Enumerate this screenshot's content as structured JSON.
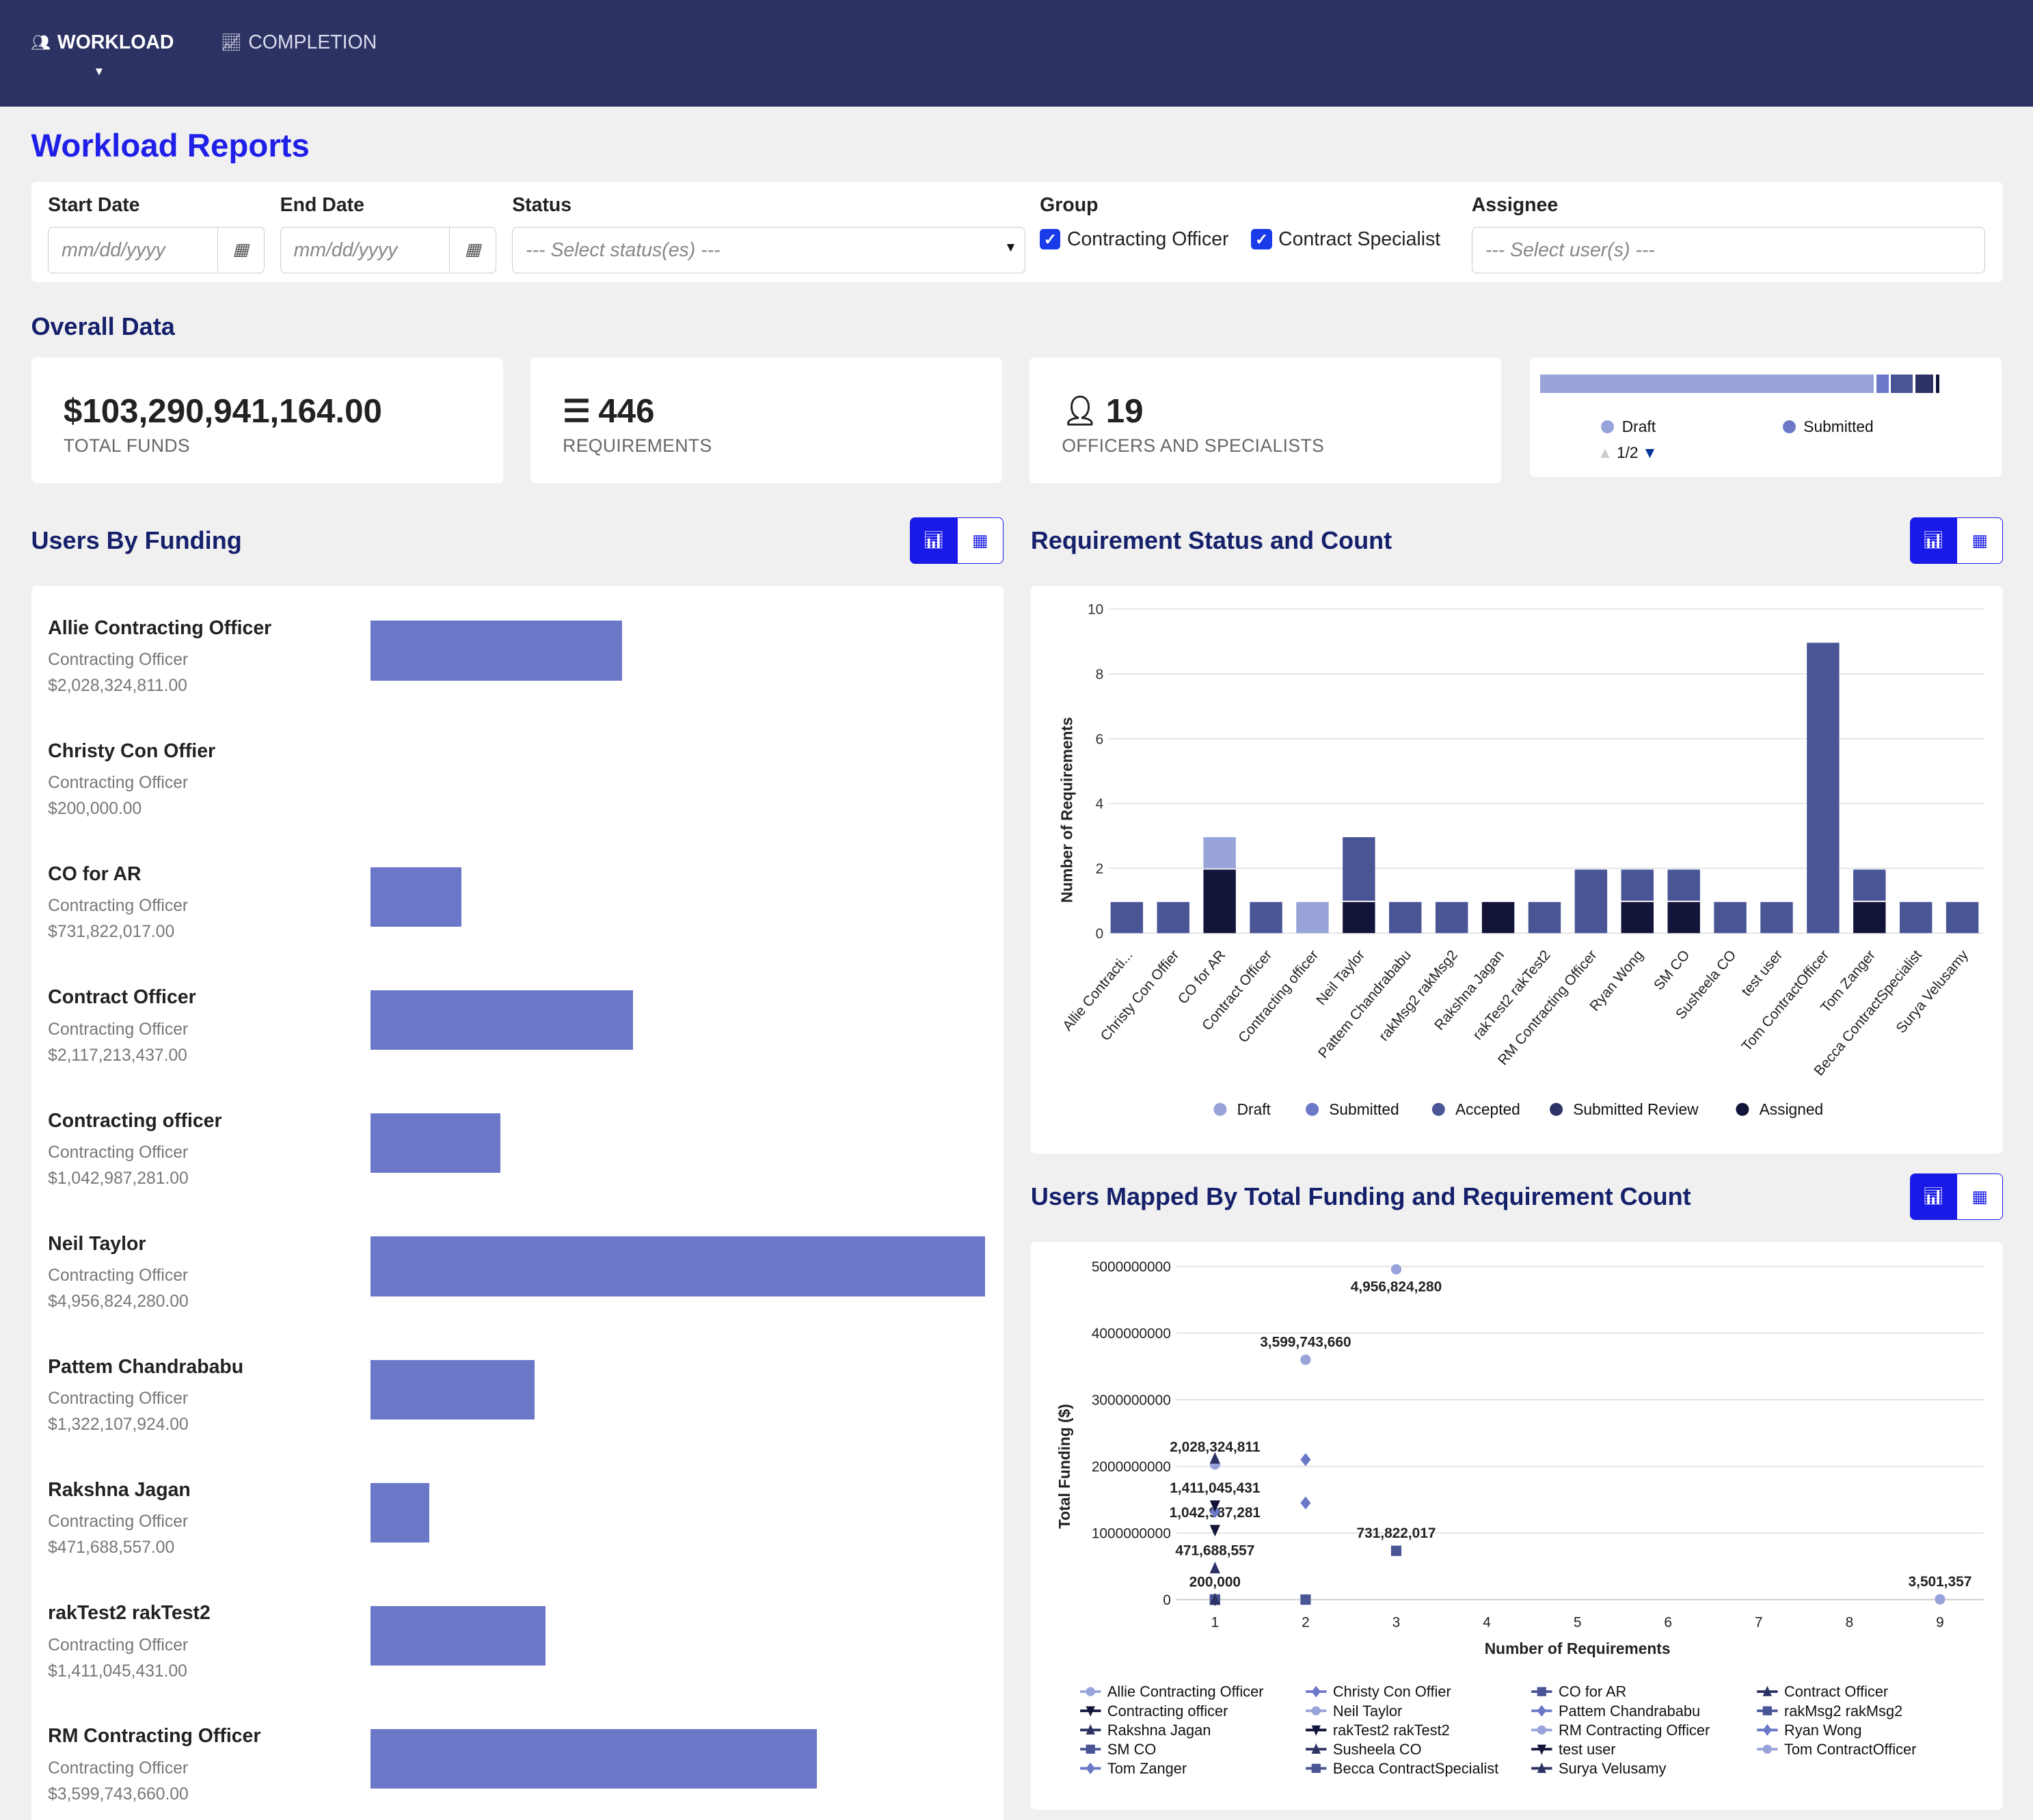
{
  "nav": {
    "items": [
      {
        "label": "WORKLOAD",
        "icon": "users-icon",
        "active": true
      },
      {
        "label": "COMPLETION",
        "icon": "line-chart-icon",
        "active": false
      }
    ]
  },
  "page": {
    "title": "Workload Reports"
  },
  "filters": {
    "start_date": {
      "label": "Start Date",
      "placeholder": "mm/dd/yyyy"
    },
    "end_date": {
      "label": "End Date",
      "placeholder": "mm/dd/yyyy"
    },
    "status": {
      "label": "Status",
      "placeholder": "--- Select status(es) ---"
    },
    "group": {
      "label": "Group",
      "options": [
        {
          "label": "Contracting Officer",
          "checked": true
        },
        {
          "label": "Contract Specialist",
          "checked": true
        }
      ]
    },
    "assignee": {
      "label": "Assignee",
      "placeholder": "--- Select user(s) ---"
    }
  },
  "overall": {
    "title": "Overall Data",
    "funds": {
      "value": "$103,290,941,164.00",
      "label": "TOTAL FUNDS"
    },
    "requirements": {
      "value": "446",
      "label": "REQUIREMENTS",
      "icon": "list-icon"
    },
    "officers": {
      "value": "19",
      "label": "OFFICERS AND SPECIALISTS",
      "icon": "user-icon"
    },
    "status_bar": {
      "segments": [
        {
          "name": "Draft",
          "fraction": 0.845,
          "color": "#97a3d9"
        },
        {
          "name": "Submitted",
          "fraction": 0.03,
          "color": "#6b78c8"
        },
        {
          "name": "Accepted",
          "fraction": 0.055,
          "color": "#4a5596"
        },
        {
          "name": "Submitted Review",
          "fraction": 0.045,
          "color": "#2c3263"
        },
        {
          "name": "Assigned",
          "fraction": 0.01,
          "color": "#12143a"
        }
      ],
      "legend": [
        "Draft",
        "Submitted"
      ],
      "page": "1/2"
    }
  },
  "users_by_funding": {
    "title": "Users By Funding",
    "max": 4956824280,
    "items": [
      {
        "name": "Allie Contracting Officer",
        "group": "Contracting Officer",
        "amount": "$2,028,324,811.00",
        "value": 2028324811
      },
      {
        "name": "Christy Con Offier",
        "group": "Contracting Officer",
        "amount": "$200,000.00",
        "value": 200000
      },
      {
        "name": "CO for AR",
        "group": "Contracting Officer",
        "amount": "$731,822,017.00",
        "value": 731822017
      },
      {
        "name": "Contract Officer",
        "group": "Contracting Officer",
        "amount": "$2,117,213,437.00",
        "value": 2117213437
      },
      {
        "name": "Contracting officer",
        "group": "Contracting Officer",
        "amount": "$1,042,987,281.00",
        "value": 1042987281
      },
      {
        "name": "Neil Taylor",
        "group": "Contracting Officer",
        "amount": "$4,956,824,280.00",
        "value": 4956824280
      },
      {
        "name": "Pattem Chandrababu",
        "group": "Contracting Officer",
        "amount": "$1,322,107,924.00",
        "value": 1322107924
      },
      {
        "name": "Rakshna Jagan",
        "group": "Contracting Officer",
        "amount": "$471,688,557.00",
        "value": 471688557
      },
      {
        "name": "rakTest2 rakTest2",
        "group": "Contracting Officer",
        "amount": "$1,411,045,431.00",
        "value": 1411045431
      },
      {
        "name": "RM Contracting Officer",
        "group": "Contracting Officer",
        "amount": "$3,599,743,660.00",
        "value": 3599743660
      }
    ]
  },
  "chart_data": [
    {
      "type": "bar",
      "stacked": true,
      "title": "Requirement Status and Count",
      "ylabel": "Number of Requirements",
      "ylim": [
        0,
        10
      ],
      "yticks": [
        0,
        2,
        4,
        6,
        8,
        10
      ],
      "grid": true,
      "legend_position": "bottom",
      "categories": [
        "Allie Contracti...",
        "Christy Con Offier",
        "CO for AR",
        "Contract Officer",
        "Contracting officer",
        "Neil Taylor",
        "Pattem Chandrababu",
        "rakMsg2 rakMsg2",
        "Rakshna Jagan",
        "rakTest2 rakTest2",
        "RM Contracting Officer",
        "Ryan Wong",
        "SM CO",
        "Susheela CO",
        "test user",
        "Tom ContractOfficer",
        "Tom Zanger",
        "Becca ContractSpecialist",
        "Surya Velusamy"
      ],
      "series": [
        {
          "name": "Draft",
          "color": "#97a3d9",
          "values": [
            0,
            0,
            1,
            0,
            1,
            0,
            0,
            0,
            0,
            0,
            0,
            0,
            0,
            0,
            0,
            0,
            0,
            0,
            0
          ]
        },
        {
          "name": "Submitted",
          "color": "#6b78c8",
          "values": [
            0,
            0,
            0,
            0,
            0,
            0,
            0,
            0,
            0,
            0,
            0,
            0,
            0,
            0,
            0,
            0,
            0,
            0,
            0
          ]
        },
        {
          "name": "Accepted",
          "color": "#4a5596",
          "values": [
            1,
            1,
            0,
            1,
            0,
            2,
            1,
            1,
            0,
            1,
            2,
            1,
            1,
            1,
            1,
            9,
            1,
            1,
            1
          ]
        },
        {
          "name": "Submitted Review",
          "color": "#2c3263",
          "values": [
            0,
            0,
            0,
            0,
            0,
            0,
            0,
            0,
            0,
            0,
            0,
            0,
            0,
            0,
            0,
            0,
            0,
            0,
            0
          ]
        },
        {
          "name": "Assigned",
          "color": "#12143a",
          "values": [
            0,
            0,
            2,
            0,
            0,
            1,
            0,
            0,
            1,
            0,
            0,
            1,
            1,
            0,
            0,
            0,
            1,
            0,
            0
          ]
        }
      ]
    },
    {
      "type": "scatter",
      "title": "Users Mapped By Total Funding and Requirement Count",
      "xlabel": "Number of Requirements",
      "ylabel": "Total Funding ($)",
      "xlim": [
        1,
        9
      ],
      "xticks": [
        1,
        2,
        3,
        4,
        5,
        6,
        7,
        8,
        9
      ],
      "ylim": [
        0,
        5000000000
      ],
      "yticks": [
        "0",
        "1000000000",
        "2000000000",
        "3000000000",
        "4000000000",
        "5000000000"
      ],
      "grid": true,
      "legend_position": "bottom",
      "series": [
        {
          "name": "Allie Contracting Officer",
          "marker": "circle",
          "color": "#97a3d9",
          "x": 1,
          "y": 2028324811,
          "label": "2,028,324,811"
        },
        {
          "name": "Christy Con Offier",
          "marker": "diamond",
          "color": "#6b78c8",
          "x": 1,
          "y": 200000,
          "label": "200,000"
        },
        {
          "name": "CO for AR",
          "marker": "square",
          "color": "#4a5596",
          "x": 3,
          "y": 731822017,
          "label": "731,822,017"
        },
        {
          "name": "Contract Officer",
          "marker": "triangle",
          "color": "#2c3263",
          "x": 1,
          "y": 2117213437
        },
        {
          "name": "Contracting officer",
          "marker": "triangle-down",
          "color": "#12143a",
          "x": 1,
          "y": 1042987281,
          "label": "1,042,987,281"
        },
        {
          "name": "Neil Taylor",
          "marker": "circle",
          "color": "#97a3d9",
          "x": 3,
          "y": 4956824280,
          "label": "4,956,824,280"
        },
        {
          "name": "Pattem Chandrababu",
          "marker": "diamond",
          "color": "#6b78c8",
          "x": 1,
          "y": 1322107924
        },
        {
          "name": "rakMsg2 rakMsg2",
          "marker": "square",
          "color": "#4a5596",
          "x": 1,
          "y": 0
        },
        {
          "name": "Rakshna Jagan",
          "marker": "triangle",
          "color": "#2c3263",
          "x": 1,
          "y": 471688557,
          "label": "471,688,557"
        },
        {
          "name": "rakTest2 rakTest2",
          "marker": "triangle-down",
          "color": "#12143a",
          "x": 1,
          "y": 1411045431,
          "label": "1,411,045,431"
        },
        {
          "name": "RM Contracting Officer",
          "marker": "circle",
          "color": "#97a3d9",
          "x": 2,
          "y": 3599743660,
          "label": "3,599,743,660"
        },
        {
          "name": "Ryan Wong",
          "marker": "diamond",
          "color": "#6b78c8",
          "x": 2,
          "y": 2100000000
        },
        {
          "name": "SM CO",
          "marker": "square",
          "color": "#4a5596",
          "x": 2,
          "y": 0
        },
        {
          "name": "Susheela CO",
          "marker": "triangle",
          "color": "#2c3263",
          "x": 1,
          "y": 0
        },
        {
          "name": "test user",
          "marker": "triangle-down",
          "color": "#12143a",
          "x": 1,
          "y": 0
        },
        {
          "name": "Tom ContractOfficer",
          "marker": "circle",
          "color": "#97a3d9",
          "x": 9,
          "y": 3501357,
          "label": "3,501,357"
        },
        {
          "name": "Tom Zanger",
          "marker": "diamond",
          "color": "#6b78c8",
          "x": 2,
          "y": 1450000000
        },
        {
          "name": "Becca ContractSpecialist",
          "marker": "square",
          "color": "#4a5596",
          "x": 1,
          "y": 0
        },
        {
          "name": "Surya Velusamy",
          "marker": "triangle",
          "color": "#2c3263",
          "x": 1,
          "y": 0
        }
      ]
    }
  ]
}
